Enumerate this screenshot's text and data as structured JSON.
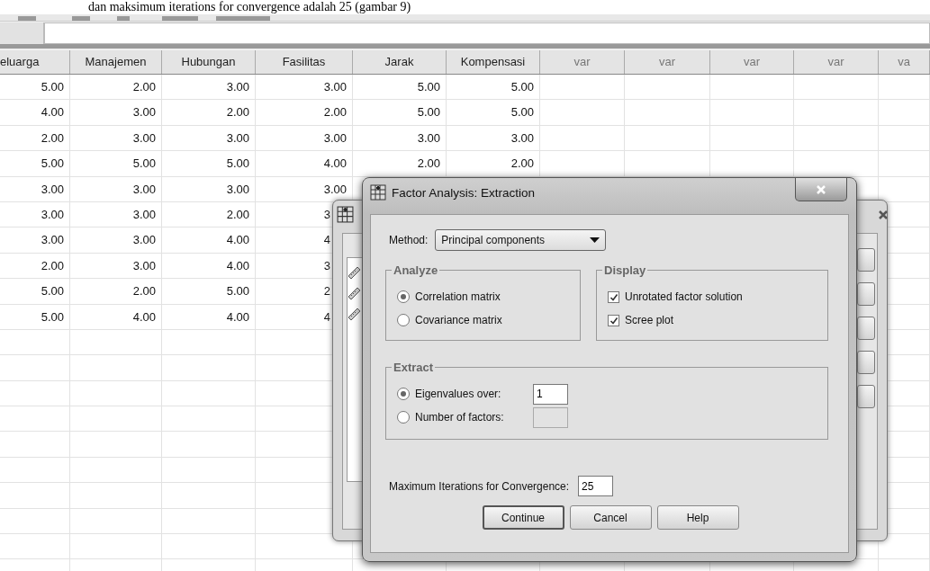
{
  "caption": "dan maksimum iterations for convergence adalah 25 (gambar 9)",
  "grid": {
    "columns": [
      "eluarga",
      "Manajemen",
      "Hubungan",
      "Fasilitas",
      "Jarak",
      "Kompensasi",
      "var",
      "var",
      "var",
      "var",
      "va"
    ],
    "rows": [
      {
        "kind": "full",
        "cells": [
          "5.00",
          "2.00",
          "3.00",
          "3.00",
          "5.00",
          "5.00"
        ]
      },
      {
        "kind": "full",
        "cells": [
          "4.00",
          "3.00",
          "2.00",
          "2.00",
          "5.00",
          "5.00"
        ]
      },
      {
        "kind": "full",
        "cells": [
          "2.00",
          "3.00",
          "3.00",
          "3.00",
          "3.00",
          "3.00"
        ]
      },
      {
        "kind": "full",
        "cells": [
          "5.00",
          "5.00",
          "5.00",
          "4.00",
          "2.00",
          "2.00"
        ]
      },
      {
        "kind": "full",
        "cells": [
          "3.00",
          "3.00",
          "3.00",
          "3.00"
        ]
      },
      {
        "kind": "partial",
        "cells": [
          "3.00",
          "3.00",
          "2.00",
          "3"
        ]
      },
      {
        "kind": "partial",
        "cells": [
          "3.00",
          "3.00",
          "4.00",
          "4"
        ]
      },
      {
        "kind": "partial",
        "cells": [
          "2.00",
          "3.00",
          "4.00",
          "3"
        ]
      },
      {
        "kind": "partial",
        "cells": [
          "5.00",
          "2.00",
          "5.00",
          "2"
        ]
      },
      {
        "kind": "partial",
        "cells": [
          "5.00",
          "4.00",
          "4.00",
          "4"
        ]
      }
    ]
  },
  "dialog": {
    "title": "Factor Analysis: Extraction",
    "method_label": "Method:",
    "method_value": "Principal components",
    "analyze": {
      "title": "Analyze",
      "options": [
        {
          "label": "Correlation matrix",
          "selected": true
        },
        {
          "label": "Covariance matrix",
          "selected": false
        }
      ]
    },
    "display": {
      "title": "Display",
      "options": [
        {
          "label": "Unrotated factor solution",
          "checked": true
        },
        {
          "label": "Scree plot",
          "checked": true
        }
      ]
    },
    "extract": {
      "title": "Extract",
      "options": [
        {
          "label": "Eigenvalues over:",
          "selected": true,
          "value": "1",
          "disabled": false
        },
        {
          "label": "Number of factors:",
          "selected": false,
          "disabled": true
        }
      ]
    },
    "max_iterations": {
      "label": "Maximum Iterations for Convergence:",
      "value": "25"
    },
    "buttons": [
      {
        "label": "Continue",
        "default": true
      },
      {
        "label": "Cancel",
        "default": false
      },
      {
        "label": "Help",
        "default": false
      }
    ]
  }
}
